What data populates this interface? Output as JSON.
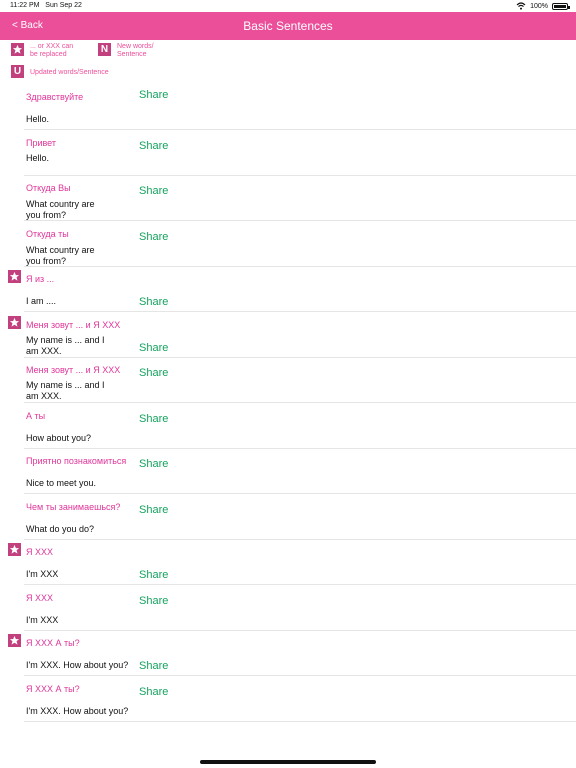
{
  "status": {
    "time": "11:22 PM",
    "date": "Sun Sep 22",
    "battery": "100%"
  },
  "nav": {
    "back": "< Back",
    "title": "Basic Sentences"
  },
  "legend": {
    "replace_text1": "... or XXX can",
    "replace_text2": "be replaced",
    "new_badge": "N",
    "new_text1": "New words/",
    "new_text2": "Sentence",
    "updated_badge": "U",
    "updated_text": "Updated words/Sentence"
  },
  "share_label": "Share",
  "rows": [
    {
      "ru": "Здравствуйте",
      "en1": "Hello.",
      "en2": ""
    },
    {
      "ru": "Привет",
      "en1": "Hello.",
      "en2": ""
    },
    {
      "ru": "Откуда Вы",
      "en1": "What country are",
      "en2": "you from?"
    },
    {
      "ru": "Откуда ты",
      "en1": "What country are",
      "en2": "you from?"
    },
    {
      "ru": "Я из ...",
      "en1": "I am ....",
      "en2": ""
    },
    {
      "ru": "Меня зовут ... и Я XXX",
      "en1": "My name is ... and I",
      "en2": "am XXX."
    },
    {
      "ru": "Меня зовут ... и Я XXX",
      "en1": "My name is ... and I",
      "en2": "am XXX."
    },
    {
      "ru": "А ты",
      "en1": "How about you?",
      "en2": ""
    },
    {
      "ru": "Приятно познакомиться",
      "en1": "Nice to meet you.",
      "en2": ""
    },
    {
      "ru": "Чем ты занимаешься?",
      "en1": "What do you do?",
      "en2": ""
    },
    {
      "ru": "Я XXX",
      "en1": "I'm XXX",
      "en2": ""
    },
    {
      "ru": "Я XXX",
      "en1": "I'm XXX",
      "en2": ""
    },
    {
      "ru": "Я XXX   А ты?",
      "en1": "I'm XXX. How about you?",
      "en2": ""
    },
    {
      "ru": "Я XXX    А ты?",
      "en1": "I'm XXX. How about you?",
      "en2": ""
    }
  ]
}
